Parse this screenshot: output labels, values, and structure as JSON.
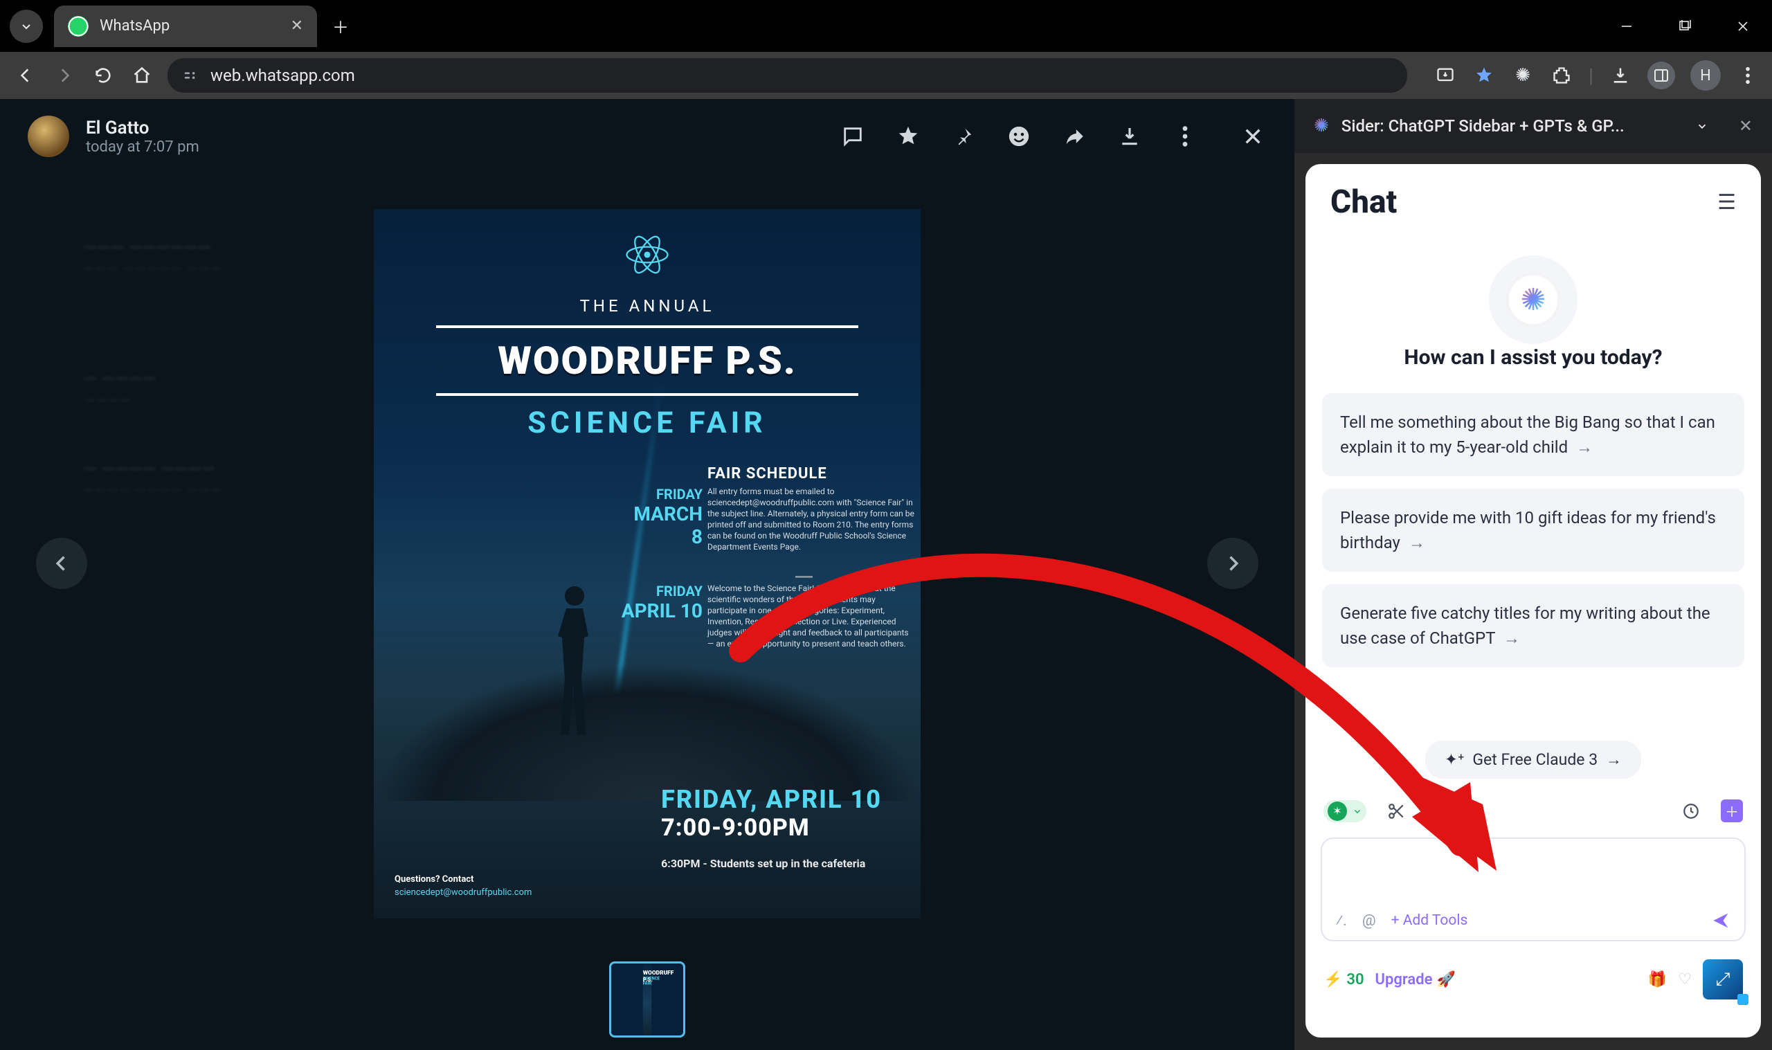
{
  "browser": {
    "tab_title": "WhatsApp",
    "url": "web.whatsapp.com",
    "avatar_initial": "H"
  },
  "mediaviewer": {
    "sender": "El Gatto",
    "timestamp": "today at 7:07 pm",
    "poster": {
      "annual": "THE ANNUAL",
      "school": "WOODRUFF P.S.",
      "subtitle": "SCIENCE FAIR",
      "schedule_title": "FAIR SCHEDULE",
      "date1_a": "FRIDAY",
      "date1_b": "MARCH 8",
      "para1": "All entry forms must be emailed to sciencedept@woodruffpublic.com with \"Science Fair\" in the subject line. Alternately, a physical entry form can be printed off and submitted to Room 210. The entry forms can be found on the Woodruff Public School's Science Department Events Page.",
      "date2_a": "FRIDAY",
      "date2_b": "APRIL 10",
      "para2": "Welcome to the Science Fair! Come learn about the scientific wonders of the world. Students may participate in one of five categories: Experiment, Invention, Research, Collection or Live. Experienced judges will give insight and feedback to all participants — an exciting opportunity to present and teach others.",
      "bottom_date": "FRIDAY, APRIL 10",
      "bottom_time": "7:00-9:00PM",
      "bottom_sub": "6:30PM - Students set up in the cafeteria",
      "q_label": "Questions? Contact",
      "q_email": "sciencedept@woodruffpublic.com"
    }
  },
  "sider": {
    "panel_title": "Sider: ChatGPT Sidebar + GPTs & GP...",
    "heading": "Chat",
    "tagline": "How can I assist you today?",
    "suggestions": [
      "Tell me something about the Big Bang so that I can explain it to my 5-year-old child",
      "Please provide me with 10 gift ideas for my friend's birthday",
      "Generate five catchy titles for my writing about the use case of ChatGPT"
    ],
    "pill": "Get Free Claude 3",
    "add_tools": "+ Add Tools",
    "credits": "30",
    "upgrade": "Upgrade"
  }
}
